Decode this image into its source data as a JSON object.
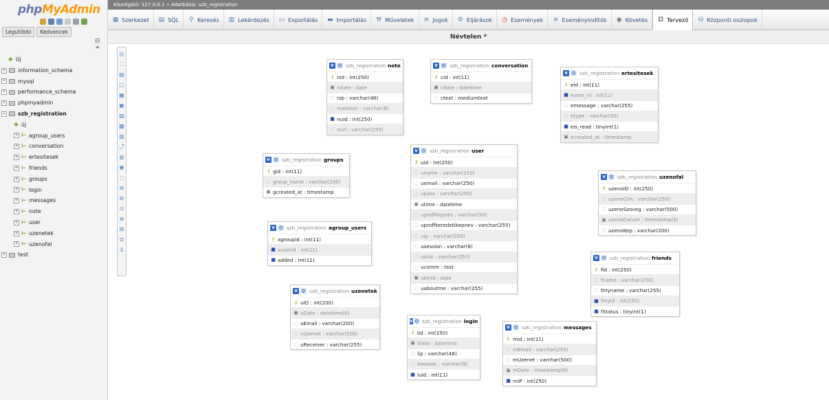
{
  "logo": {
    "part1": "php",
    "part2": "MyAdmin"
  },
  "left_tabs": [
    "Legutóbbi",
    "Kedvencek"
  ],
  "tree": [
    {
      "label": "Új",
      "kind": "new",
      "level": 0
    },
    {
      "label": "information_schema",
      "kind": "db",
      "level": 0
    },
    {
      "label": "mysql",
      "kind": "db",
      "level": 0
    },
    {
      "label": "performance_schema",
      "kind": "db",
      "level": 0
    },
    {
      "label": "phpmyadmin",
      "kind": "db",
      "level": 0
    },
    {
      "label": "szb_registration",
      "kind": "db-open",
      "level": 0
    },
    {
      "label": "új",
      "kind": "new",
      "level": 1
    },
    {
      "label": "agroup_users",
      "kind": "table",
      "level": 1
    },
    {
      "label": "conversation",
      "kind": "table",
      "level": 1
    },
    {
      "label": "ertesitesek",
      "kind": "table",
      "level": 1
    },
    {
      "label": "friends",
      "kind": "table",
      "level": 1
    },
    {
      "label": "groups",
      "kind": "table",
      "level": 1
    },
    {
      "label": "login",
      "kind": "table",
      "level": 1
    },
    {
      "label": "messages",
      "kind": "table",
      "level": 1
    },
    {
      "label": "note",
      "kind": "table",
      "level": 1
    },
    {
      "label": "user",
      "kind": "table",
      "level": 1
    },
    {
      "label": "uzenetek",
      "kind": "table",
      "level": 1
    },
    {
      "label": "uzenofal",
      "kind": "table",
      "level": 1
    },
    {
      "label": "test",
      "kind": "db",
      "level": 0
    }
  ],
  "breadcrumb": "Kiszolgáló: 127.0.0.1 » Adatbázis: szb_registration",
  "menu": [
    {
      "label": "Szerkezet",
      "icon": "structure-icon"
    },
    {
      "label": "SQL",
      "icon": "sql-icon"
    },
    {
      "label": "Keresés",
      "icon": "search-icon"
    },
    {
      "label": "Lekérdezés",
      "icon": "query-icon"
    },
    {
      "label": "Exportálás",
      "icon": "export-icon"
    },
    {
      "label": "Importálás",
      "icon": "import-icon"
    },
    {
      "label": "Műveletek",
      "icon": "wrench-icon"
    },
    {
      "label": "Jogok",
      "icon": "privileges-icon"
    },
    {
      "label": "Eljárások",
      "icon": "routines-icon"
    },
    {
      "label": "Események",
      "icon": "clock-icon"
    },
    {
      "label": "Eseményindítók",
      "icon": "triggers-icon"
    },
    {
      "label": "Követés",
      "icon": "eye-icon"
    },
    {
      "label": "Tervező",
      "icon": "designer-icon",
      "active": true
    },
    {
      "label": "Központi oszlopok",
      "icon": "columns-icon"
    }
  ],
  "designer_title": "Névtelen *",
  "db_prefix": "szb_registration",
  "tables": [
    {
      "name": "note",
      "fields": [
        {
          "text": "nid : int(250)",
          "t": "key"
        },
        {
          "text": "ndate : date",
          "t": "date",
          "alt": true
        },
        {
          "text": "nip : varchar(48)",
          "t": "col"
        },
        {
          "text": "nsession : varchar(8)",
          "t": "col",
          "alt": true
        },
        {
          "text": "nuid : int(250)",
          "t": "idx"
        },
        {
          "text": "nurl : varchar(250)",
          "t": "col",
          "alt": true
        }
      ]
    },
    {
      "name": "conversation",
      "fields": [
        {
          "text": "cid : int(11)",
          "t": "key"
        },
        {
          "text": "cdate : datetime",
          "t": "date",
          "alt": true
        },
        {
          "text": "ctext : mediumtext",
          "t": "col"
        }
      ]
    },
    {
      "name": "ertesitesek",
      "fields": [
        {
          "text": "eid : int(11)",
          "t": "key"
        },
        {
          "text": "euser_id : int(11)",
          "t": "idx",
          "alt": true
        },
        {
          "text": "emessage : varchar(255)",
          "t": "col"
        },
        {
          "text": "etype : varchar(50)",
          "t": "col",
          "alt": true
        },
        {
          "text": "eis_read : tinyint(1)",
          "t": "idx"
        },
        {
          "text": "ecreated_at : timestamp",
          "t": "date",
          "alt": true
        }
      ]
    },
    {
      "name": "groups",
      "fields": [
        {
          "text": "gid : int(11)",
          "t": "key"
        },
        {
          "text": "group_name : varchar(100)",
          "t": "col",
          "alt": true
        },
        {
          "text": "gcreated_at : timestamp",
          "t": "date"
        }
      ]
    },
    {
      "name": "user",
      "fields": [
        {
          "text": "uid : int(250)",
          "t": "key"
        },
        {
          "text": "uname : varchar(250)",
          "t": "col",
          "alt": true
        },
        {
          "text": "uemail : varchar(250)",
          "t": "col"
        },
        {
          "text": "upass : varchar(250)",
          "t": "col",
          "alt": true
        },
        {
          "text": "utime : datetime",
          "t": "date"
        },
        {
          "text": "uproffkepnev : varchar(50)",
          "t": "col",
          "alt": true
        },
        {
          "text": "uproffkeredetikepnev : varchar(255)",
          "t": "col"
        },
        {
          "text": "uip : varchar(250)",
          "t": "col",
          "alt": true
        },
        {
          "text": "usession : varchar(8)",
          "t": "col"
        },
        {
          "text": "ustat : varchar(250)",
          "t": "col",
          "alt": true
        },
        {
          "text": "ucomm : text",
          "t": "col"
        },
        {
          "text": "ubirtd : date",
          "t": "date",
          "alt": true
        },
        {
          "text": "uaboutme : varchar(255)",
          "t": "col"
        }
      ]
    },
    {
      "name": "uzenofal",
      "fields": [
        {
          "text": "uzenoID : int(250)",
          "t": "key"
        },
        {
          "text": "uzenoCim : varchar(250)",
          "t": "col",
          "alt": true
        },
        {
          "text": "uzenoSzoveg : varchar(500)",
          "t": "col"
        },
        {
          "text": "uzenoDatum : timestamp(6)",
          "t": "date",
          "alt": true
        },
        {
          "text": "uzenoKep : varchar(200)",
          "t": "col"
        }
      ]
    },
    {
      "name": "agroup_users",
      "fields": [
        {
          "text": "agroupid : int(11)",
          "t": "key"
        },
        {
          "text": "auserid : int(11)",
          "t": "idx",
          "alt": true
        },
        {
          "text": "added : int(11)",
          "t": "idx"
        }
      ]
    },
    {
      "name": "friends",
      "fields": [
        {
          "text": "fid : int(250)",
          "t": "key"
        },
        {
          "text": "fname : varchar(250)",
          "t": "col",
          "alt": true
        },
        {
          "text": "fmyname : varchar(255)",
          "t": "col"
        },
        {
          "text": "fmyid : int(250)",
          "t": "idx",
          "alt": true
        },
        {
          "text": "fStatus : tinyint(1)",
          "t": "idx"
        }
      ]
    },
    {
      "name": "uzenetek",
      "fields": [
        {
          "text": "uID : int(200)",
          "t": "key"
        },
        {
          "text": "uDate : datetime(6)",
          "t": "date",
          "alt": true
        },
        {
          "text": "uEmail : varchar(200)",
          "t": "col"
        },
        {
          "text": "uUzenet : varchar(500)",
          "t": "col",
          "alt": true
        },
        {
          "text": "uReceiver : varchar(255)",
          "t": "col"
        }
      ]
    },
    {
      "name": "login",
      "fields": [
        {
          "text": "lid : int(250)",
          "t": "key"
        },
        {
          "text": "ldate : datetime",
          "t": "date",
          "alt": true
        },
        {
          "text": "lip : varchar(48)",
          "t": "col"
        },
        {
          "text": "lsession : varchar(8)",
          "t": "col",
          "alt": true
        },
        {
          "text": "luid : int(11)",
          "t": "idx"
        }
      ]
    },
    {
      "name": "messages",
      "fields": [
        {
          "text": "mid : int(11)",
          "t": "key"
        },
        {
          "text": "mEmail : varchar(250)",
          "t": "col",
          "alt": true
        },
        {
          "text": "mUzenet : varchar(500)",
          "t": "col"
        },
        {
          "text": "mDate : timestamp(6)",
          "t": "date",
          "alt": true
        },
        {
          "text": "mIP : int(250)",
          "t": "idx"
        }
      ]
    }
  ]
}
